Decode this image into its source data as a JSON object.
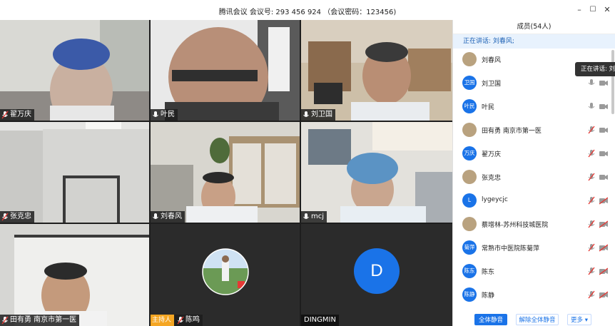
{
  "window": {
    "title": "腾讯会议 会议号: 293 456 924 （会议密码：123456)",
    "minimize": "–",
    "maximize": "☐",
    "close": "✕"
  },
  "video_tiles": [
    {
      "name": "翟万庆",
      "mic": "muted"
    },
    {
      "name": "叶民",
      "mic": "on"
    },
    {
      "name": "刘卫国",
      "mic": "on"
    },
    {
      "name": "张克忠",
      "mic": "muted"
    },
    {
      "name": "刘春风",
      "mic": "on"
    },
    {
      "name": "mcj",
      "mic": "on"
    },
    {
      "name": "田有勇 南京市第一医",
      "mic": "muted"
    },
    {
      "name": "陈鸣",
      "mic": "muted",
      "host_badge": "主持人"
    },
    {
      "name": "DINGMIN",
      "avatar_letter": "D"
    }
  ],
  "panel": {
    "header": "成员(54人)",
    "speaking": "正在讲话: 刘春风;",
    "tooltip": "正在讲话: 刘春风",
    "members": [
      {
        "name": "刘春风",
        "avatar": "",
        "photo": true,
        "mic": "none",
        "cam": "none"
      },
      {
        "name": "刘卫国",
        "avatar": "卫国",
        "photo": false,
        "mic": "on",
        "cam": "on"
      },
      {
        "name": "叶民",
        "avatar": "叶民",
        "photo": false,
        "mic": "on",
        "cam": "on"
      },
      {
        "name": "田有勇 南京市第一医",
        "avatar": "",
        "photo": true,
        "mic": "muted",
        "cam": "on"
      },
      {
        "name": "翟万庆",
        "avatar": "万庆",
        "photo": false,
        "mic": "muted",
        "cam": "on"
      },
      {
        "name": "张克忠",
        "avatar": "",
        "photo": true,
        "mic": "muted",
        "cam": "on"
      },
      {
        "name": "lygeycjc",
        "avatar": "L",
        "photo": false,
        "mic": "muted",
        "cam": "off"
      },
      {
        "name": "蔡增林-苏州科技城医院",
        "avatar": "",
        "photo": true,
        "mic": "muted",
        "cam": "off"
      },
      {
        "name": "常熟市中医院陈菊萍",
        "avatar": "菊萍",
        "photo": false,
        "mic": "muted",
        "cam": "off"
      },
      {
        "name": "陈东",
        "avatar": "陈东",
        "photo": false,
        "mic": "muted",
        "cam": "off"
      },
      {
        "name": "陈静",
        "avatar": "陈静",
        "photo": false,
        "mic": "muted",
        "cam": "off"
      }
    ],
    "footer": {
      "mute_all": "全体静音",
      "unmute_all": "解除全体静音",
      "more": "更多 ▾"
    }
  },
  "colors": {
    "accent": "#1a73e8",
    "muted_red": "#e53935",
    "host_badge": "#f5a623"
  }
}
